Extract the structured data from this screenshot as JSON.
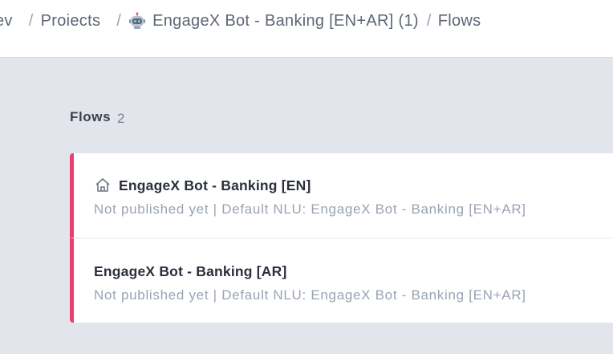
{
  "breadcrumb": {
    "items": [
      "ev",
      "Proiects",
      "EngageX Bot - Banking [EN+AR] (1)",
      "Flows"
    ],
    "separator": "/"
  },
  "section": {
    "title": "Flows",
    "count": "2"
  },
  "flows": [
    {
      "name": "EngageX Bot - Banking [EN]",
      "subtitle": "Not published yet | Default NLU: EngageX Bot - Banking [EN+AR]",
      "icon": "home-icon"
    },
    {
      "name": "EngageX Bot - Banking [AR]",
      "subtitle": "Not published yet | Default NLU: EngageX Bot - Banking [EN+AR]"
    }
  ],
  "colors": {
    "accent": "#ec3f6e",
    "background": "#e2e5ec",
    "muted_text": "#9aa3b2"
  }
}
